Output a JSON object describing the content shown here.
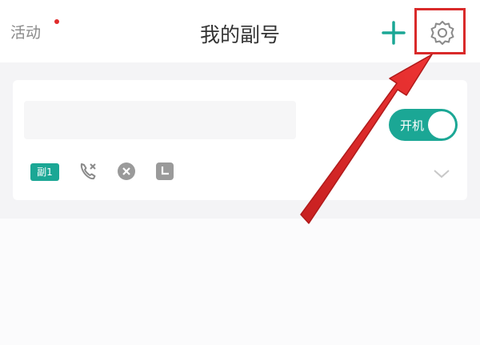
{
  "header": {
    "activity_label": "活动",
    "title": "我的副号",
    "icons": {
      "add": "plus-icon",
      "settings": "gear-icon"
    }
  },
  "card": {
    "toggle_label": "开机",
    "badge_label": "副1",
    "icons": [
      "call-blocked-icon",
      "close-circle-icon",
      "clock-icon",
      "chevron-down-icon"
    ]
  },
  "colors": {
    "accent": "#1ba795",
    "highlight": "#d92a2a",
    "notice_dot": "#e02b2b"
  }
}
